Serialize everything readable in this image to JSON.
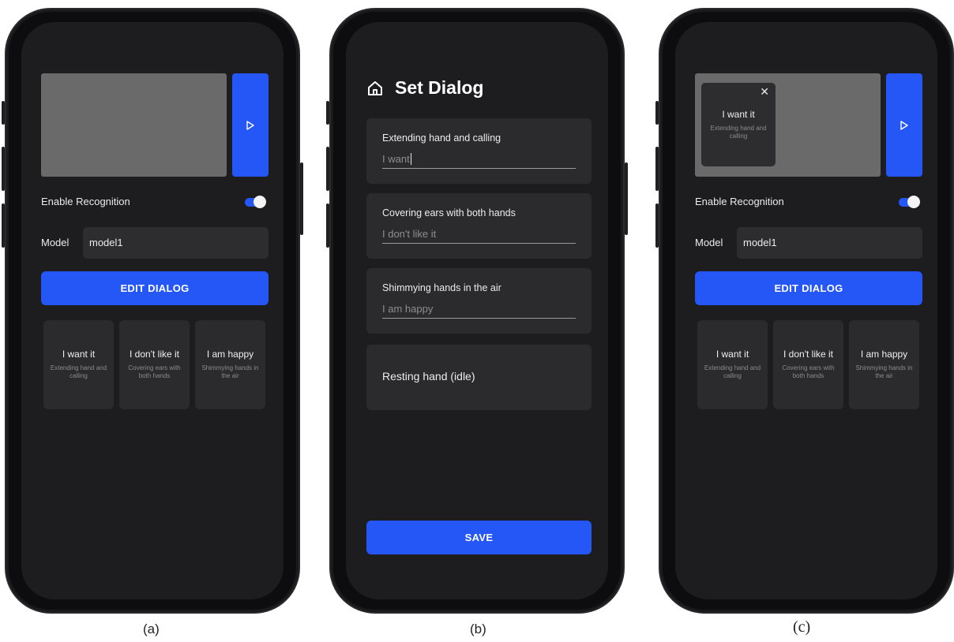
{
  "colors": {
    "accent": "#2457f5",
    "screen": "#1d1d20",
    "card": "#2b2b2e",
    "preview": "#6a6a6a"
  },
  "panel_a": {
    "caption": "(a)",
    "play_icon": "play-icon",
    "recognition_label": "Enable Recognition",
    "recognition_enabled": true,
    "model_label": "Model",
    "model_value": "model1",
    "edit_button": "EDIT DIALOG",
    "cards": [
      {
        "phrase": "I want it",
        "gesture": "Extending hand and calling"
      },
      {
        "phrase": "I don't like it",
        "gesture": "Covering ears with both hands"
      },
      {
        "phrase": "I am happy",
        "gesture": "Shimmying hands in the air"
      }
    ]
  },
  "panel_b": {
    "caption": "(b)",
    "home_icon": "home-icon",
    "title": "Set Dialog",
    "entries": [
      {
        "gesture": "Extending hand and calling",
        "phrase": "I want"
      },
      {
        "gesture": "Covering ears with both hands",
        "phrase": "I don't like it"
      },
      {
        "gesture": "Shimmying hands in the air",
        "phrase": "I am happy"
      },
      {
        "gesture": "Resting hand (idle)"
      }
    ],
    "save_button": "SAVE"
  },
  "panel_c": {
    "caption": "(c)",
    "popup": {
      "close_icon": "close-icon",
      "close_glyph": "✕",
      "phrase": "I want it",
      "gesture": "Extending hand and calling"
    },
    "play_icon": "play-icon",
    "recognition_label": "Enable Recognition",
    "recognition_enabled": true,
    "model_label": "Model",
    "model_value": "model1",
    "edit_button": "EDIT DIALOG",
    "cards": [
      {
        "phrase": "I want it",
        "gesture": "Extending hand and calling"
      },
      {
        "phrase": "I don't like it",
        "gesture": "Covering ears with both hands"
      },
      {
        "phrase": "I am happy",
        "gesture": "Shimmying hands in the air"
      }
    ]
  }
}
